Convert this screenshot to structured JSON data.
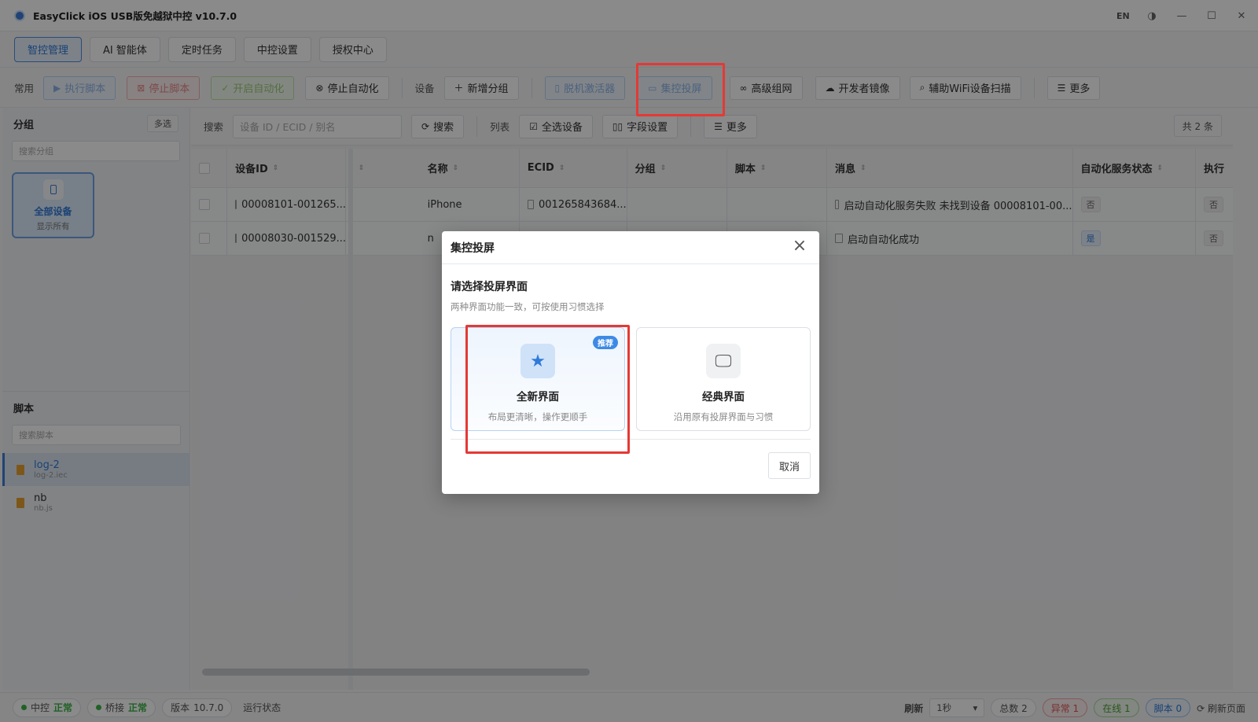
{
  "window": {
    "title": "EasyClick iOS USB版免越狱中控 v10.7.0",
    "lang": "EN",
    "controls": [
      "◑",
      "—",
      "☐",
      "✕"
    ]
  },
  "tabs": [
    "智控管理",
    "AI 智能体",
    "定时任务",
    "中控设置",
    "授权中心"
  ],
  "toolbar": {
    "common_label": "常用",
    "run_script": "执行脚本",
    "stop_script": "停止脚本",
    "start_auto": "开启自动化",
    "stop_auto": "停止自动化",
    "device_label": "设备",
    "add_group": "新增分组",
    "offline_activator": "脱机激活器",
    "group_cast": "集控投屏",
    "advanced_network": "高级组网",
    "dev_mirror": "开发者镜像",
    "wifi_scan": "辅助WiFi设备扫描",
    "more": "更多"
  },
  "left": {
    "group_title": "分组",
    "multi_select": "多选",
    "group_search_placeholder": "搜索分组",
    "all_devices": "全部设备",
    "show_all": "显示所有",
    "script_title": "脚本",
    "script_search_placeholder": "搜索脚本",
    "scripts": [
      {
        "name": "log-2",
        "file": "log-2.iec"
      },
      {
        "name": "nb",
        "file": "nb.js"
      }
    ]
  },
  "filter": {
    "search_label": "搜索",
    "search_placeholder": "设备 ID / ECID / 别名",
    "search_btn": "搜索",
    "list_label": "列表",
    "select_all": "全选设备",
    "field_settings": "字段设置",
    "more": "更多",
    "total": "共 2 条"
  },
  "table": {
    "headers": [
      "设备ID",
      "",
      "名称",
      "ECID",
      "分组",
      "脚本",
      "消息",
      "自动化服务状态",
      "执行"
    ],
    "rows": [
      {
        "id": "00008101-001265...",
        "name": "iPhone",
        "ecid": "001265843684...",
        "group": "",
        "script": "",
        "message": "启动自动化服务失败 未找到设备 00008101-00...",
        "auto_status": "否",
        "exec": "否"
      },
      {
        "id": "00008030-001529...",
        "name": "n",
        "ecid": "",
        "group": "",
        "script": "",
        "message": "启动自动化成功",
        "auto_status": "是",
        "exec": "否"
      }
    ]
  },
  "modal": {
    "title": "集控投屏",
    "heading": "请选择投屏界面",
    "subtitle": "两种界面功能一致，可按使用习惯选择",
    "new_ui": {
      "title": "全新界面",
      "desc": "布局更清晰，操作更顺手",
      "badge": "推荐"
    },
    "classic_ui": {
      "title": "经典界面",
      "desc": "沿用原有投屏界面与习惯"
    },
    "cancel": "取消"
  },
  "status": {
    "hub_label": "中控",
    "hub_state": "正常",
    "bridge_label": "桥接",
    "bridge_state": "正常",
    "version_label": "版本",
    "version": "10.7.0",
    "run_state": "运行状态",
    "refresh_label": "刷新",
    "refresh_value": "1秒",
    "total": "总数 2",
    "error": "异常 1",
    "online": "在线 1",
    "script": "脚本 0",
    "refresh_page": "刷新页面"
  },
  "colors": {
    "accent": "#2f7ad9",
    "highlight_box": "#e53935",
    "badge": "#3d8ae6"
  }
}
